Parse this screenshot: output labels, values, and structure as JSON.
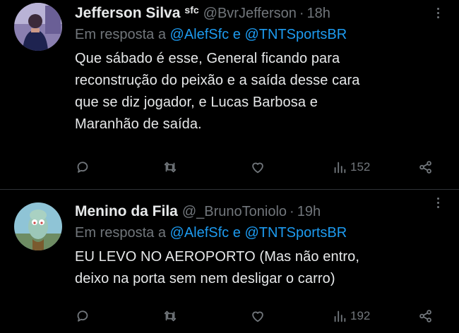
{
  "tweets": [
    {
      "name": "Jefferson Silva",
      "badge": "sfc",
      "handle": "@BvrJefferson",
      "separator": "·",
      "time": "18h",
      "reply_prefix": "Em resposta a",
      "mention_1": "@AlefSfc",
      "mention_joiner": "e",
      "mention_2": "@TNTSportsBR",
      "lines": [
        "Que sábado é esse, General ficando para",
        "reconstrução do peixão e a saída desse cara",
        "que se diz jogador, e Lucas Barbosa e",
        "Maranhão de saída."
      ],
      "views": "152",
      "icons": [
        "reply-icon",
        "retweet-icon",
        "like-icon",
        "views-icon",
        "share-icon"
      ]
    },
    {
      "name": "Menino da Fila",
      "handle": "@_BrunoToniolo",
      "separator": "·",
      "time": "19h",
      "reply_prefix": "Em resposta a",
      "mention_1": "@AlefSfc",
      "mention_joiner": "e",
      "mention_2": "@TNTSportsBR",
      "lines": [
        "EU LEVO NO AEROPORTO (Mas não entro,",
        "deixo na porta sem nem desligar o carro)"
      ],
      "views": "192",
      "icons": [
        "reply-icon",
        "retweet-icon",
        "like-icon",
        "views-icon",
        "share-icon"
      ]
    }
  ],
  "colors": {
    "background": "#000000",
    "text": "#e7e9ea",
    "muted": "#71767b",
    "link": "#1d9bf0",
    "divider": "#2f3336"
  }
}
